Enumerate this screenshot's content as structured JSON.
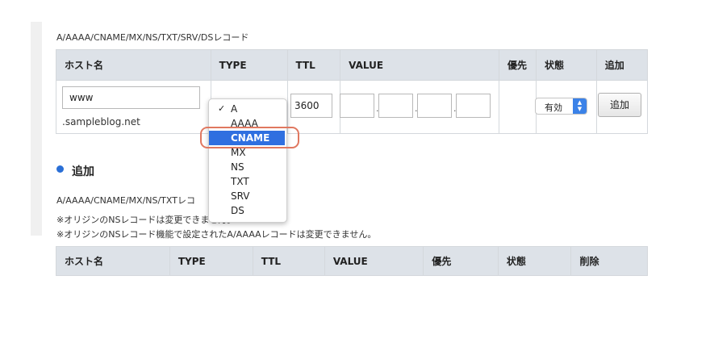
{
  "top_caption": "A/AAAA/CNAME/MX/NS/TXT/SRV/DSレコード",
  "edit_table": {
    "headers": [
      "ホスト名",
      "TYPE",
      "TTL",
      "VALUE",
      "優先",
      "状態",
      "追加"
    ],
    "host_value": "www",
    "host_suffix": ".sampleblog.net",
    "ttl_value": "3600",
    "status_value": "有効",
    "add_button": "追加"
  },
  "type_dropdown": {
    "options": [
      "A",
      "AAAA",
      "CNAME",
      "MX",
      "NS",
      "TXT",
      "SRV",
      "DS"
    ],
    "checked": "A",
    "highlighted": "CNAME"
  },
  "section": {
    "title": "追加",
    "caption": "A/AAAA/CNAME/MX/NS/TXTレコ",
    "note1": "※オリジンのNSレコードは変更できません。",
    "note2": "※オリジンのNSレコード機能で設定されたA/AAAAレコードは変更できません。"
  },
  "list_table": {
    "headers": [
      "ホスト名",
      "TYPE",
      "TTL",
      "VALUE",
      "優先",
      "状態",
      "削除"
    ]
  },
  "colors": {
    "header_bg": "#dde2e8",
    "accent": "#2f6fe0",
    "highlight_ring": "#e07860"
  }
}
